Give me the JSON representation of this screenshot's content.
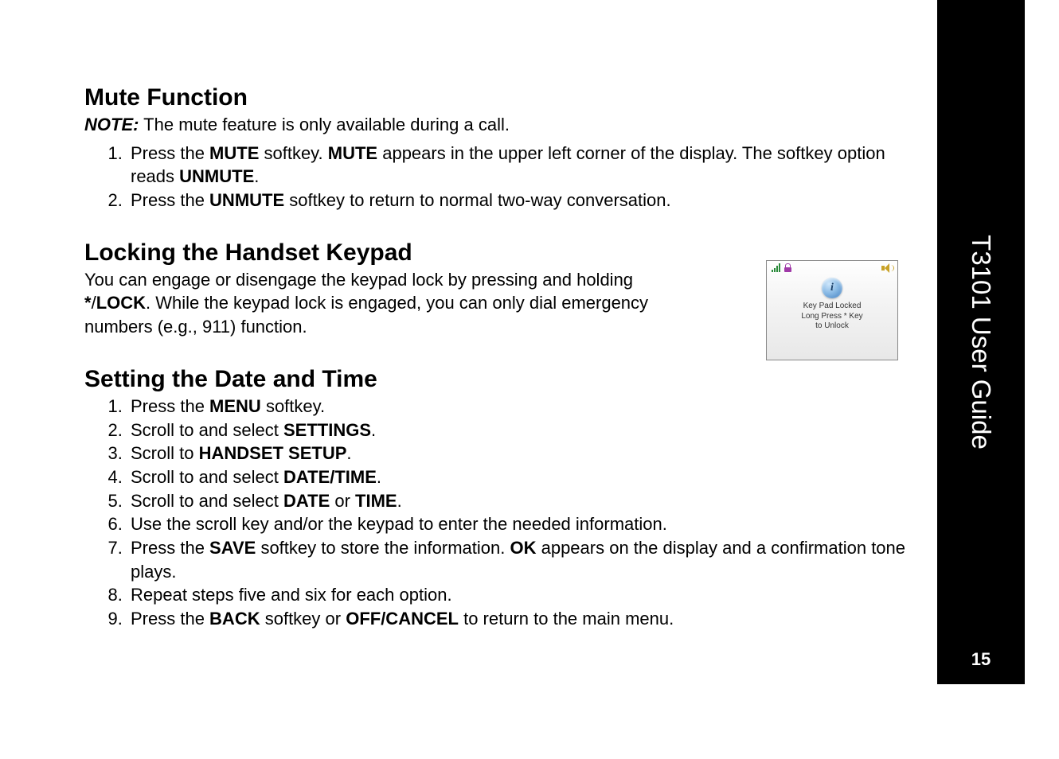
{
  "sidebar": {
    "title": "T3101 User Guide",
    "page_number": "15"
  },
  "sections": {
    "mute": {
      "heading": "Mute Function",
      "note_label": "NOTE:",
      "note_rest": " The mute feature is only available during a call.",
      "step1_a": "Press the ",
      "step1_b": "MUTE",
      "step1_c": " softkey. ",
      "step1_d": "MUTE",
      "step1_e": " appears in the upper left corner of the display. The softkey option reads ",
      "step1_f": "UNMUTE",
      "step1_g": ".",
      "step2_a": "Press the ",
      "step2_b": "UNMUTE",
      "step2_c": " softkey to return to normal two-way conversation."
    },
    "lock": {
      "heading": "Locking the Handset Keypad",
      "body_a": "You can engage or disengage the keypad lock by pressing and holding ",
      "body_b": "*",
      "body_c": "/",
      "body_d": "LOCK",
      "body_e": ". While the keypad lock is engaged, you can only dial emergency numbers (e.g., 911) function."
    },
    "datetime": {
      "heading": "Setting the Date and Time",
      "s1_a": "Press the ",
      "s1_b": "MENU",
      "s1_c": " softkey.",
      "s2_a": "Scroll to and select ",
      "s2_b": "SETTINGS",
      "s2_c": ".",
      "s3_a": "Scroll to ",
      "s3_b": "HANDSET SETUP",
      "s3_c": ".",
      "s4_a": "Scroll to and select ",
      "s4_b": "DATE/TIME",
      "s4_c": ".",
      "s5_a": "Scroll to and select ",
      "s5_b": "DATE",
      "s5_c": " or ",
      "s5_d": "TIME",
      "s5_e": ".",
      "s6": "Use the scroll key and/or the keypad to enter the needed information.",
      "s7_a": "Press the ",
      "s7_b": "SAVE",
      "s7_c": " softkey to store the information. ",
      "s7_d": "OK",
      "s7_e": " appears on the display and a confirmation tone plays.",
      "s8": "Repeat steps five and six for each option.",
      "s9_a": "Press the ",
      "s9_b": "BACK",
      "s9_c": " softkey or ",
      "s9_d": "OFF/CANCEL",
      "s9_e": " to return to the main menu."
    }
  },
  "phone_screen": {
    "info_glyph": "i",
    "line1": "Key Pad Locked",
    "line2": "Long Press * Key",
    "line3": "to Unlock"
  }
}
